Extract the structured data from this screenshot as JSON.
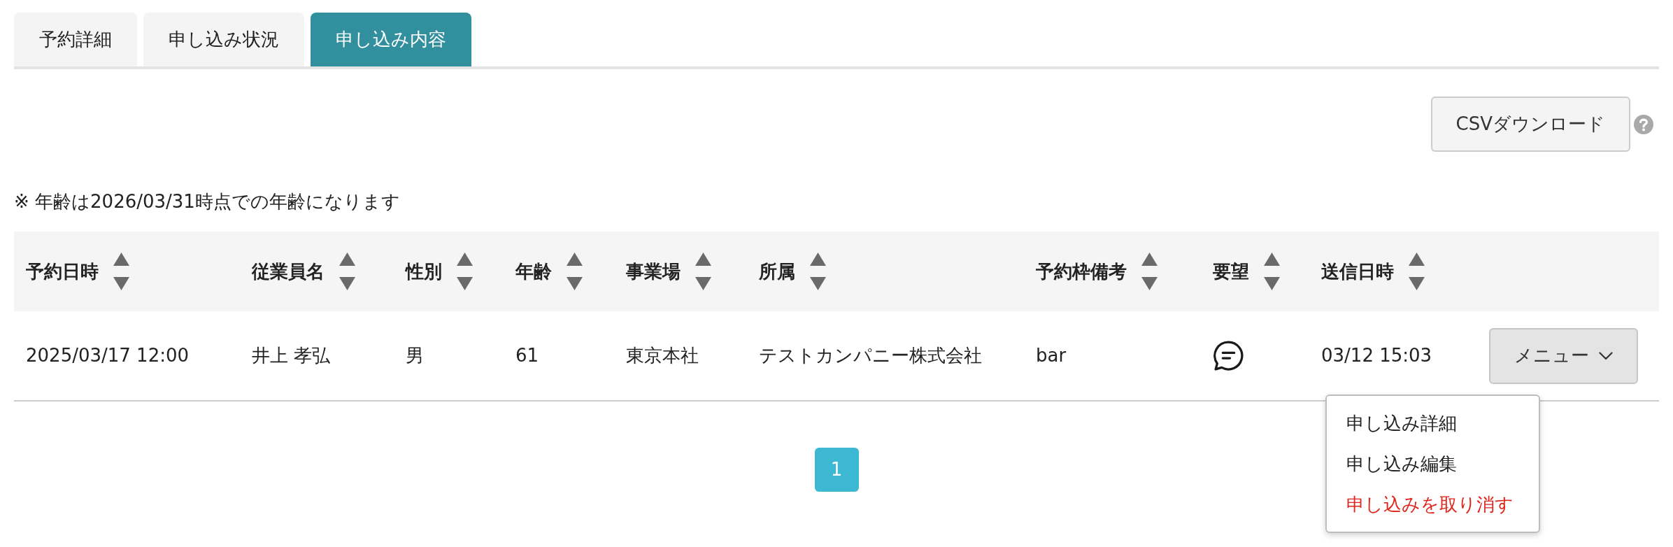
{
  "tabs": [
    {
      "label": "予約詳細",
      "selected": false
    },
    {
      "label": "申し込み状況",
      "selected": false
    },
    {
      "label": "申し込み内容",
      "selected": true
    }
  ],
  "toolbar": {
    "csv_button": "CSVダウンロード"
  },
  "note": "※ 年齢は2026/03/31時点での年齢になります",
  "table": {
    "columns": [
      "予約日時",
      "従業員名",
      "性別",
      "年齢",
      "事業場",
      "所属",
      "予約枠備考",
      "要望",
      "送信日時"
    ],
    "rows": [
      {
        "cells": [
          {
            "kind": "text",
            "text": "2025/03/17 12:00"
          },
          {
            "kind": "text",
            "text": "井上 孝弘"
          },
          {
            "kind": "text",
            "text": "男"
          },
          {
            "kind": "text",
            "text": "61"
          },
          {
            "kind": "text",
            "text": "東京本社"
          },
          {
            "kind": "text",
            "text": "テストカンパニー株式会社"
          },
          {
            "kind": "text",
            "text": "bar"
          },
          {
            "kind": "request_icon"
          },
          {
            "kind": "text",
            "text": "03/12 15:03"
          }
        ],
        "menu": {
          "label": "メニュー",
          "expanded": true,
          "items": [
            {
              "label": "申し込み詳細",
              "kind": "normal"
            },
            {
              "label": "申し込み編集",
              "kind": "normal"
            },
            {
              "label": "申し込みを取り消す",
              "kind": "danger"
            }
          ]
        }
      }
    ]
  },
  "pagination": {
    "pages": [
      {
        "label": "1",
        "selected": true
      }
    ]
  }
}
